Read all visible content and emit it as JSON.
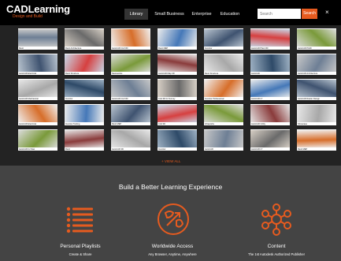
{
  "header": {
    "logo": "CADLearning",
    "logo_tagline": "Design and Build",
    "nav": [
      "Library",
      "Small Business",
      "Enterprise",
      "Education"
    ],
    "search_placeholder": "Search",
    "search_button": "Search",
    "close": "×"
  },
  "library": {
    "tiles": [
      "Revit",
      "Revit Architecture",
      "AutoCAD Civil 3D",
      "Revit MEP",
      "Inventor",
      "AutoCAD Plant 3D",
      "AutoCAD P&ID",
      "AutoCAD Electrical",
      "Revit Structure",
      "Navisworks",
      "AutoCAD Map 3D",
      "Revit Structure",
      "AutoCAD",
      "AutoCAD Architecture",
      "AutoCAD Mechanical",
      "Inventor",
      "AutoCAD Civil 3D",
      "Civil 3D for Survey",
      "Inventor Professional",
      "AutoCAD LT",
      "AutoCAD Raster Design",
      "AutoCAD Electrical",
      "Inventor Tooling",
      "Revit MEP",
      "Civil 3D",
      "Infraworks",
      "AutoCAD Utility",
      "Showcase",
      "AutoCAD for Mac",
      "Revit",
      "AutoCAD 3D",
      "Inventor",
      "AutoCAD",
      "AutoCAD LT",
      "Revit MEP"
    ],
    "more_link": "+ VIEW ALL"
  },
  "promo": {
    "title": "Build a Better Learning Experience",
    "features": [
      {
        "title": "Personal Playlists",
        "subtitle": "Create & Share",
        "icon": "list-icon"
      },
      {
        "title": "Worldwide Access",
        "subtitle": "Any Browser, Anytime, Anywhere",
        "icon": "globe-icon"
      },
      {
        "title": "Content",
        "subtitle": "The 1st Autodesk Authorized Publisher",
        "icon": "network-icon"
      }
    ]
  },
  "colors": {
    "accent": "#e65b1f",
    "header_bg": "#000000",
    "library_bg": "#232323",
    "promo_bg": "#444444"
  }
}
